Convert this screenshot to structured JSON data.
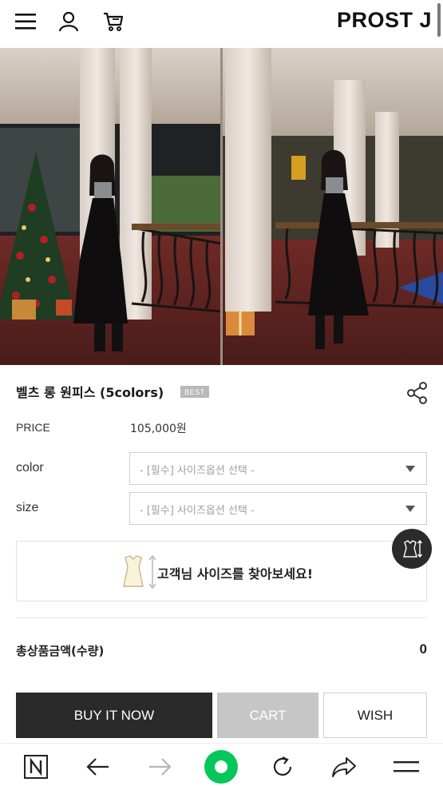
{
  "header": {
    "brand": "PROST J",
    "icons": [
      "menu-icon",
      "user-icon",
      "cart-icon"
    ]
  },
  "product": {
    "name": "벨츠 롱 원피스 (5colors)",
    "badge": "BEST",
    "price_label": "PRICE",
    "price_value": "105,000원"
  },
  "options": {
    "color_label": "color",
    "color_placeholder": "- [필수] 사이즈옵션 선택 -",
    "size_label": "size",
    "size_placeholder": "- [필수] 사이즈옵션 선택 -"
  },
  "size_finder": {
    "text": "고객님 사이즈를 찾아보세요!"
  },
  "total": {
    "label": "총상품금액(수량)",
    "value": "0"
  },
  "actions": {
    "buy": "BUY IT NOW",
    "cart": "CART",
    "wish": "WISH"
  },
  "browser_bar": {
    "icons": [
      "naver-n-icon",
      "back-arrow-icon",
      "forward-arrow-icon",
      "green-dot-icon",
      "refresh-icon",
      "share-arrow-icon",
      "menu-lines-icon"
    ],
    "colors": {
      "green": "#03c75a"
    }
  },
  "colors": {
    "buy_bg": "#2a2a2a",
    "cart_bg": "#c6c6c6",
    "badge_bg": "#b9b9b9"
  }
}
